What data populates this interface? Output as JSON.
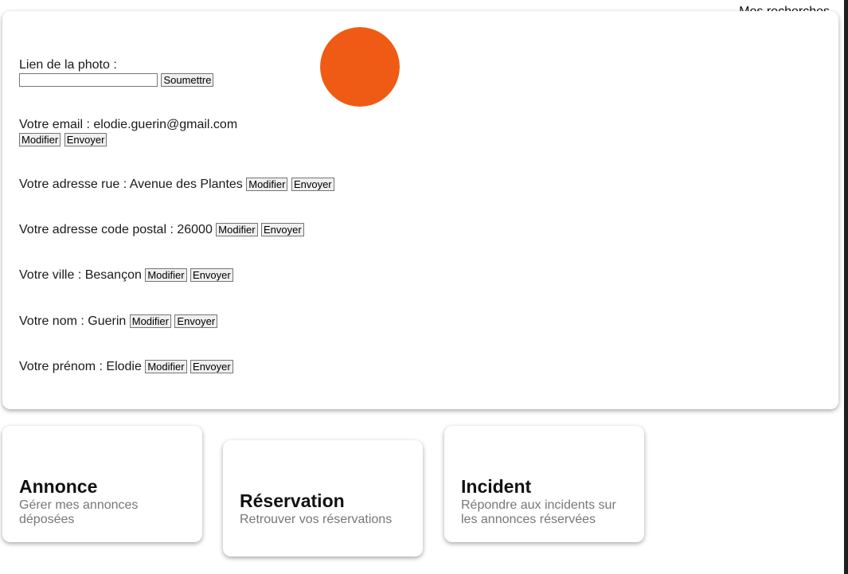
{
  "header": {
    "searches_link": "Mes recherches"
  },
  "profile": {
    "avatar_color": "#ef5b15",
    "photo": {
      "label": "Lien de la photo :",
      "input_value": "",
      "submit_label": "Soumettre"
    },
    "email": {
      "text": "Votre email : elodie.guerin@gmail.com"
    },
    "street": {
      "text": "Votre adresse rue : Avenue des Plantes"
    },
    "postal": {
      "text": "Votre adresse code postal : 26000"
    },
    "city": {
      "text": "Votre ville : Besançon"
    },
    "lastname": {
      "text": "Votre nom : Guerin"
    },
    "firstname": {
      "text": "Votre prénom : Elodie"
    },
    "modify_label": "Modifier",
    "send_label": "Envoyer"
  },
  "cards": [
    {
      "title": "Annonce",
      "desc": "Gérer mes annonces déposées"
    },
    {
      "title": "Réservation",
      "desc": "Retrouver vos réservations"
    },
    {
      "title": "Incident",
      "desc": "Répondre aux incidents sur les annonces réservées"
    }
  ]
}
